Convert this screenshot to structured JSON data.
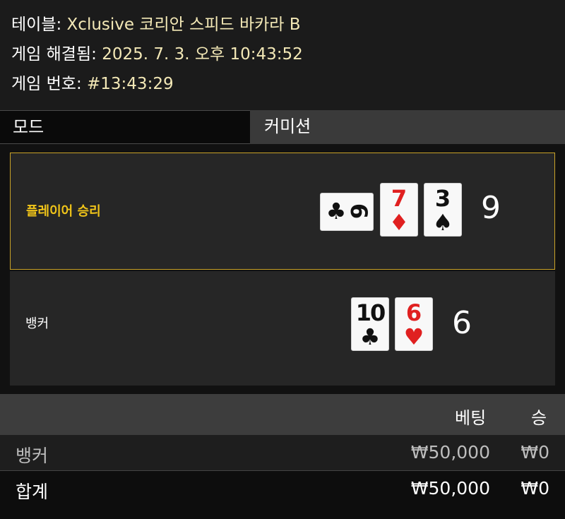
{
  "info": {
    "table_label": "테이블:",
    "table_value": "Xclusive 코리안 스피드 바카라 B",
    "resolved_label": "게임 해결됨:",
    "resolved_value": "2025. 7. 3. 오후 10:43:52",
    "game_no_label": "게임 번호:",
    "game_no_value": "#13:43:29"
  },
  "mode": {
    "label": "모드",
    "value": "커미션"
  },
  "player": {
    "label": "플레이어 승리",
    "score": "9",
    "cards": [
      {
        "rank": "6",
        "suit": "♣",
        "color": "black",
        "rotated": true
      },
      {
        "rank": "7",
        "suit": "♦",
        "color": "red"
      },
      {
        "rank": "3",
        "suit": "♠",
        "color": "black"
      }
    ]
  },
  "banker": {
    "label": "뱅커",
    "score": "6",
    "cards": [
      {
        "rank": "10",
        "suit": "♣",
        "color": "black"
      },
      {
        "rank": "6",
        "suit": "♥",
        "color": "red"
      }
    ]
  },
  "bets": {
    "header_bet": "베팅",
    "header_win": "승",
    "rows": [
      {
        "name": "뱅커",
        "bet": "₩50,000",
        "win": "₩0"
      }
    ],
    "total": {
      "name": "합계",
      "bet": "₩50,000",
      "win": "₩0"
    }
  },
  "colors": {
    "winner_border": "#c9a227",
    "winner_label": "#f0c419",
    "info_value": "#f3e8b6",
    "card_red": "#e02020"
  }
}
